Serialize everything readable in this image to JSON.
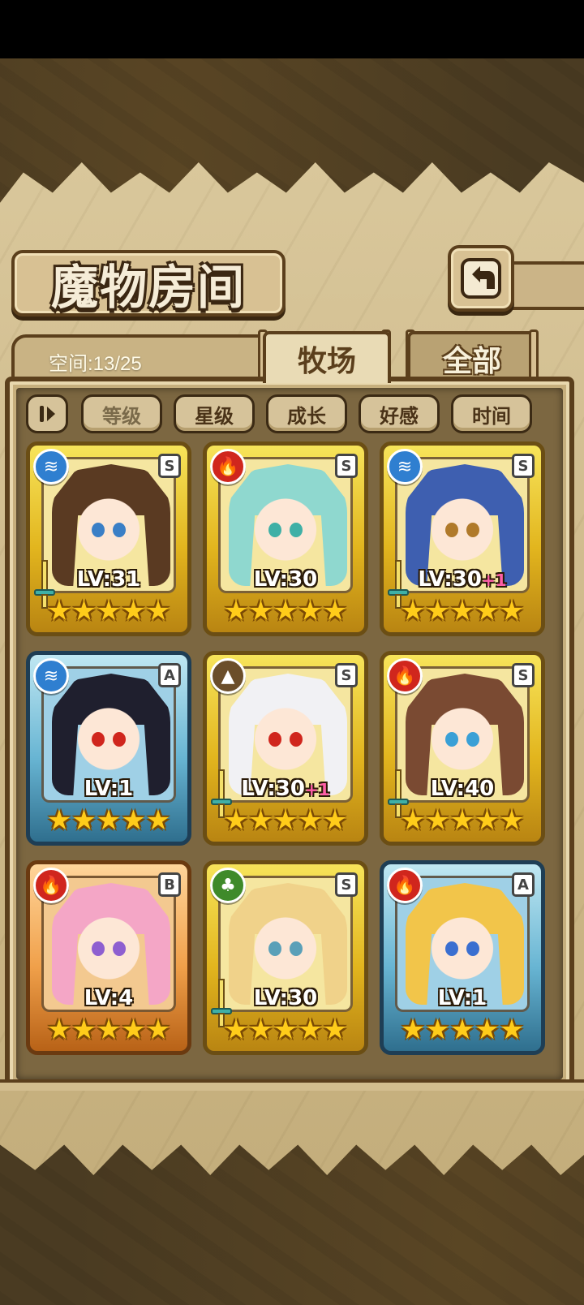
{
  "title": "魔物房间",
  "capacity": "空间:13/25",
  "tabs": [
    {
      "label": "牧场",
      "active": true
    },
    {
      "label": "全部",
      "active": false
    }
  ],
  "sort_toggle_label": "⏸",
  "sort_buttons": [
    "等级",
    "星级",
    "成长",
    "好感",
    "时间"
  ],
  "colors": {
    "water": "#2f7fd0",
    "fire": "#d0261d",
    "earth": "#6b4e2a",
    "wood": "#3f8a2a"
  },
  "cards": [
    {
      "element": "water-icon",
      "rank": "S",
      "frame": "gold",
      "level": "LV:31",
      "bonus": "",
      "stars": "★★★★★",
      "weapon": true
    },
    {
      "element": "fire-icon",
      "rank": "S",
      "frame": "gold",
      "level": "LV:30",
      "bonus": "",
      "stars": "★★★★★",
      "weapon": false
    },
    {
      "element": "water-icon",
      "rank": "S",
      "frame": "gold",
      "level": "LV:30",
      "bonus": "+1",
      "stars": "★★★★★",
      "weapon": true
    },
    {
      "element": "water-icon",
      "rank": "A",
      "frame": "blue",
      "level": "LV:1",
      "bonus": "",
      "stars": "★★★★★",
      "weapon": false
    },
    {
      "element": "earth-icon",
      "rank": "S",
      "frame": "gold",
      "level": "LV:30",
      "bonus": "+1",
      "stars": "★★★★★",
      "weapon": true
    },
    {
      "element": "fire-icon",
      "rank": "S",
      "frame": "gold",
      "level": "LV:40",
      "bonus": "",
      "stars": "★★★★★",
      "weapon": true
    },
    {
      "element": "fire-icon",
      "rank": "B",
      "frame": "orange",
      "level": "LV:4",
      "bonus": "",
      "stars": "★★★★★",
      "weapon": false
    },
    {
      "element": "wood-icon",
      "rank": "S",
      "frame": "gold",
      "level": "LV:30",
      "bonus": "",
      "stars": "★★★★★",
      "weapon": true
    },
    {
      "element": "fire-icon",
      "rank": "A",
      "frame": "blue",
      "level": "LV:1",
      "bonus": "",
      "stars": "★★★★★",
      "weapon": false
    }
  ]
}
